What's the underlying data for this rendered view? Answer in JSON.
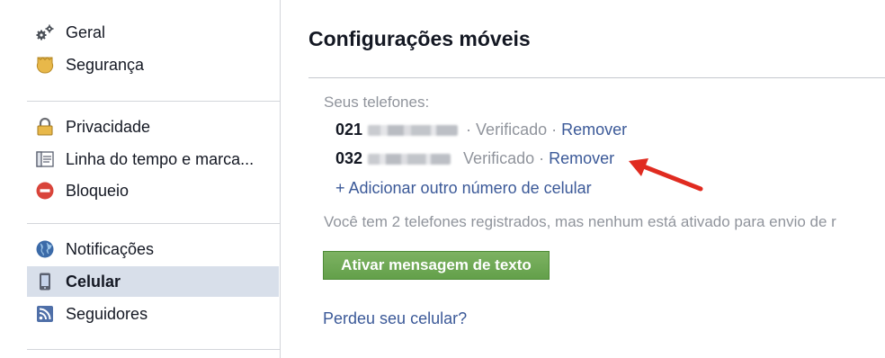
{
  "sidebar": {
    "groups": [
      [
        {
          "label": "Geral",
          "icon": "gears-icon"
        },
        {
          "label": "Segurança",
          "icon": "security-badge-icon"
        }
      ],
      [
        {
          "label": "Privacidade",
          "icon": "lock-icon"
        },
        {
          "label": "Linha do tempo e marca...",
          "icon": "timeline-icon"
        },
        {
          "label": "Bloqueio",
          "icon": "block-icon"
        }
      ],
      [
        {
          "label": "Notificações",
          "icon": "globe-icon"
        },
        {
          "label": "Celular",
          "icon": "mobile-phone-icon",
          "active": true
        },
        {
          "label": "Seguidores",
          "icon": "rss-icon"
        }
      ]
    ]
  },
  "main": {
    "title": "Configurações móveis",
    "phones_label": "Seus telefones:",
    "phones": [
      {
        "prefix": "021",
        "status": "Verificado",
        "separator": "·",
        "action": "Remover"
      },
      {
        "prefix": "032",
        "status": "Verificado",
        "separator": "·",
        "action": "Remover"
      }
    ],
    "add_phone": "+ Adicionar outro número de celular",
    "info_text": "Você tem 2 telefones registrados, mas nenhum está ativado para envio de r",
    "activate_button": "Ativar mensagem de texto",
    "lost_phone": "Perdeu seu celular?"
  },
  "colors": {
    "link": "#3b5998",
    "muted": "#90949c",
    "button_green": "#69a74e",
    "active_bg": "#d8dfea",
    "annotation_arrow": "#e02b20"
  }
}
